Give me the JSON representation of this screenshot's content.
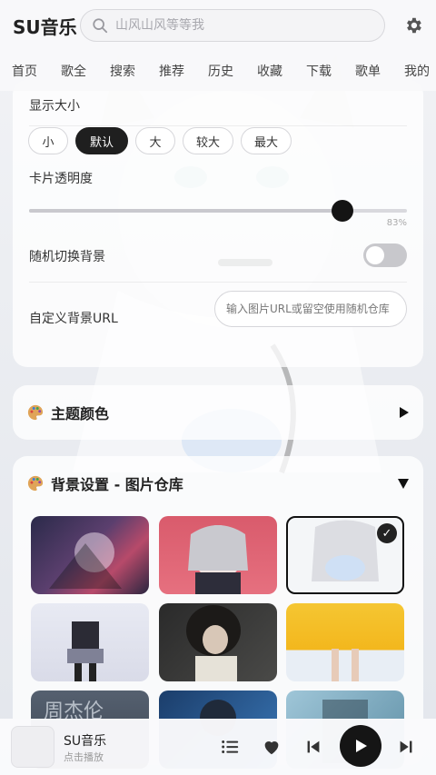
{
  "header": {
    "app_title": "SU音乐",
    "search_placeholder": "山风山风等等我"
  },
  "nav": {
    "items": [
      "首页",
      "歌全",
      "搜索",
      "推荐",
      "历史",
      "收藏",
      "下载",
      "歌单",
      "我的"
    ]
  },
  "display_settings": {
    "size_label": "显示大小",
    "size_options": [
      "小",
      "默认",
      "大",
      "较大",
      "最大"
    ],
    "selected_size": "默认",
    "opacity_label": "卡片透明度",
    "opacity_value": 0.83,
    "opacity_text": "83%",
    "random_bg_label": "随机切换背景",
    "random_bg_enabled": false,
    "custom_url_label": "自定义背景URL",
    "custom_url_placeholder": "输入图片URL或留空使用随机仓库"
  },
  "theme_section": {
    "title": "主题颜色"
  },
  "background_section": {
    "title": "背景设置 - 图片仓库",
    "selected_index": 2
  },
  "player": {
    "title": "SU音乐",
    "subtitle": "点击播放"
  },
  "colors": {
    "accent": "#151515",
    "background": "#eceef2"
  }
}
